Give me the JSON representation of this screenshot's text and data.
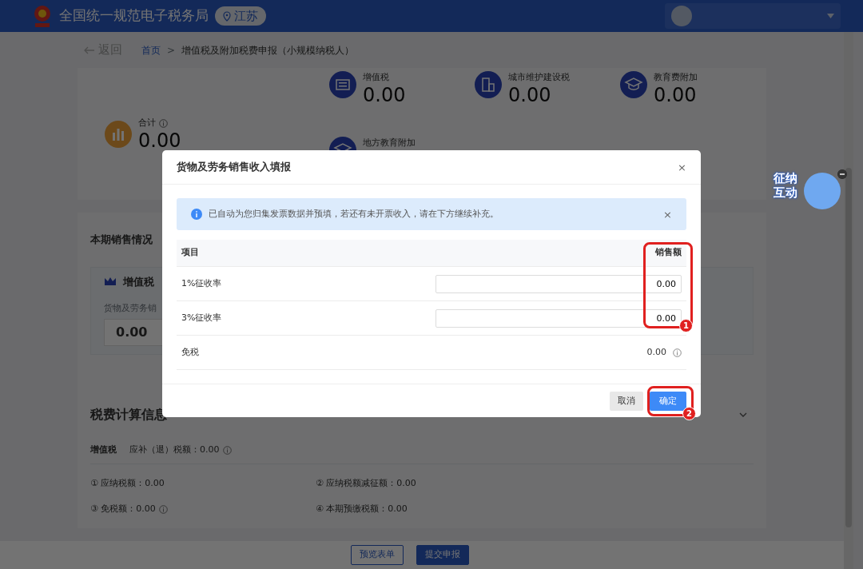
{
  "header": {
    "title": "全国统一规范电子税务局",
    "region": "江苏"
  },
  "breadcrumb": {
    "back": "返回",
    "home": "首页",
    "separator": ">",
    "current": "增值税及附加税费申报（小规模纳税人）"
  },
  "summary": {
    "total": {
      "label": "合计",
      "value": "0.00"
    },
    "items": [
      {
        "label": "增值税",
        "value": "0.00",
        "kind": "tax"
      },
      {
        "label": "城市维护建设税",
        "value": "0.00",
        "kind": "building"
      },
      {
        "label": "教育费附加",
        "value": "0.00",
        "kind": "education"
      },
      {
        "label": "地方教育附加",
        "kind": "education"
      }
    ]
  },
  "sales": {
    "title": "本期销售情况",
    "panel_title": "增值税",
    "field_label": "货物及劳务销",
    "field_value": "0.00"
  },
  "tax_calc": {
    "title": "税费计算信息",
    "tax_name": "增值税",
    "due": "应补（退）税额：0.00",
    "items": [
      {
        "text": "① 应纳税额：0.00",
        "info": false
      },
      {
        "text": "② 应纳税额减征额：0.00",
        "info": false
      },
      {
        "text": "③ 免税额：0.00",
        "info": true
      },
      {
        "text": "④ 本期预缴税额：0.00",
        "info": false
      }
    ]
  },
  "footer_buttons": [
    {
      "label": "预览表单",
      "kind": "outline"
    },
    {
      "label": "提交申报",
      "kind": "primary"
    }
  ],
  "mascot": {
    "text": "征纳互动"
  },
  "dialog": {
    "title": "货物及劳务销售收入填报",
    "close": "×",
    "alert": {
      "text": "已自动为您归集发票数据并预填，若还有未开票收入，请在下方继续补充。",
      "close": "×"
    },
    "columns": [
      "项目",
      "销售额"
    ],
    "rows": [
      {
        "label": "1%征收率",
        "kind": "input",
        "value": "0.00",
        "info": false
      },
      {
        "label": "3%征收率",
        "kind": "input",
        "value": "0.00",
        "info": false
      },
      {
        "label": "免税",
        "kind": "text",
        "value": "0.00",
        "info": true
      }
    ],
    "buttons": [
      {
        "label": "取消",
        "kind": "secondary"
      },
      {
        "label": "确定",
        "kind": "primary"
      }
    ]
  },
  "annotations": [
    {
      "number": "1"
    },
    {
      "number": "2"
    }
  ]
}
